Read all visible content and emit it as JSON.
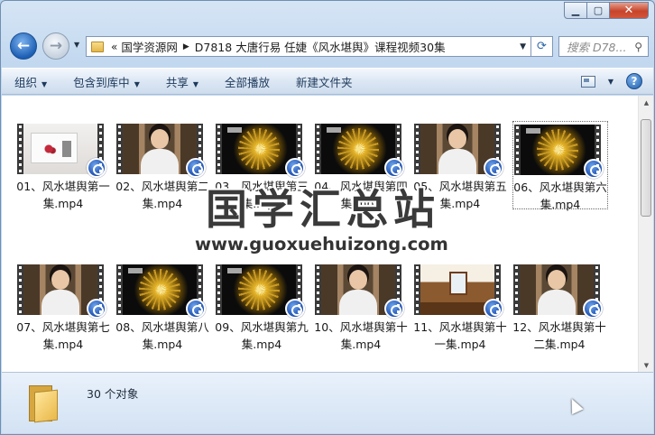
{
  "address": {
    "chevron": "«",
    "crumbs": [
      "国学资源网",
      "D7818 大唐行易 任婕《风水堪舆》课程视频30集"
    ]
  },
  "search": {
    "placeholder": "搜索 D78..."
  },
  "toolbar": {
    "organize": "组织",
    "include_library": "包含到库中",
    "share": "共享",
    "play_all": "全部播放",
    "new_folder": "新建文件夹"
  },
  "files": [
    {
      "name": "01、风水堪舆第一集.mp4",
      "scene": "painting"
    },
    {
      "name": "02、风水堪舆第二集.mp4",
      "scene": "person"
    },
    {
      "name": "03、风水堪舆第三集.mp4",
      "scene": "firework"
    },
    {
      "name": "04、风水堪舆第四集.mp4",
      "scene": "firework"
    },
    {
      "name": "05、风水堪舆第五集.mp4",
      "scene": "person"
    },
    {
      "name": "06、风水堪舆第六集.mp4",
      "scene": "firework",
      "selected": true
    },
    {
      "name": "07、风水堪舆第七集.mp4",
      "scene": "person"
    },
    {
      "name": "08、风水堪舆第八集.mp4",
      "scene": "firework"
    },
    {
      "name": "09、风水堪舆第九集.mp4",
      "scene": "firework"
    },
    {
      "name": "10、风水堪舆第十集.mp4",
      "scene": "person"
    },
    {
      "name": "11、风水堪舆第十一集.mp4",
      "scene": "room"
    },
    {
      "name": "12、风水堪舆第十二集.mp4",
      "scene": "person"
    }
  ],
  "watermark": {
    "title": "国学汇总站",
    "url": "www.guoxuehuizong.com"
  },
  "status": {
    "count": "30 个对象"
  },
  "icons": {
    "back": "back-arrow-icon",
    "forward": "forward-arrow-icon",
    "refresh": "refresh-icon",
    "search": "search-icon",
    "help": "help-icon",
    "views": "change-view-icon",
    "folder": "folder-icon",
    "play_badge": "media-player-badge-icon"
  }
}
